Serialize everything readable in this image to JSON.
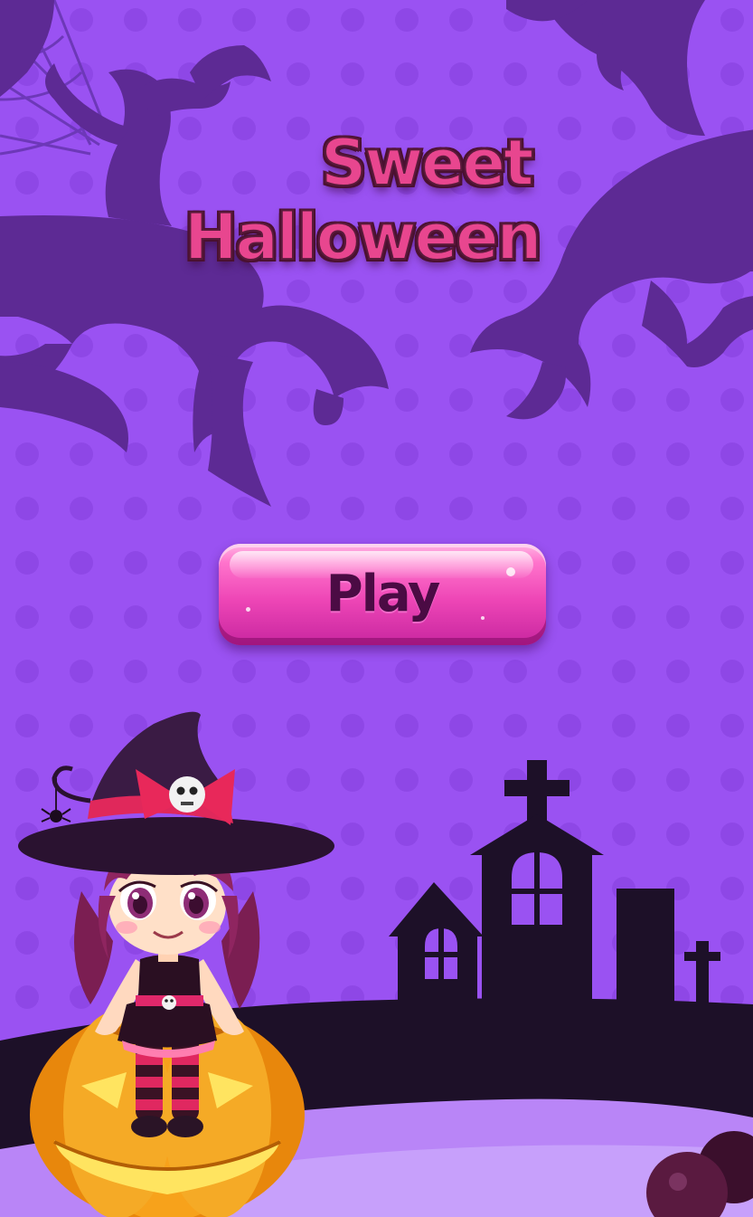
{
  "game": {
    "title_line_1": "Sweet",
    "title_line_2": "Halloween",
    "play_label": "Play"
  },
  "colors": {
    "background": "#9a52f2",
    "tree_silhouette": "#5d2a94",
    "title_pink": "#e8468f",
    "title_outline": "#4a1130",
    "play_button": "#ee46b6",
    "ground_dark": "#1d1028",
    "pumpkin_orange": "#f7a21b"
  },
  "icons": {
    "hat_badge": "skull-icon",
    "belt_badge": "skull-icon",
    "spider": "spider-icon"
  }
}
